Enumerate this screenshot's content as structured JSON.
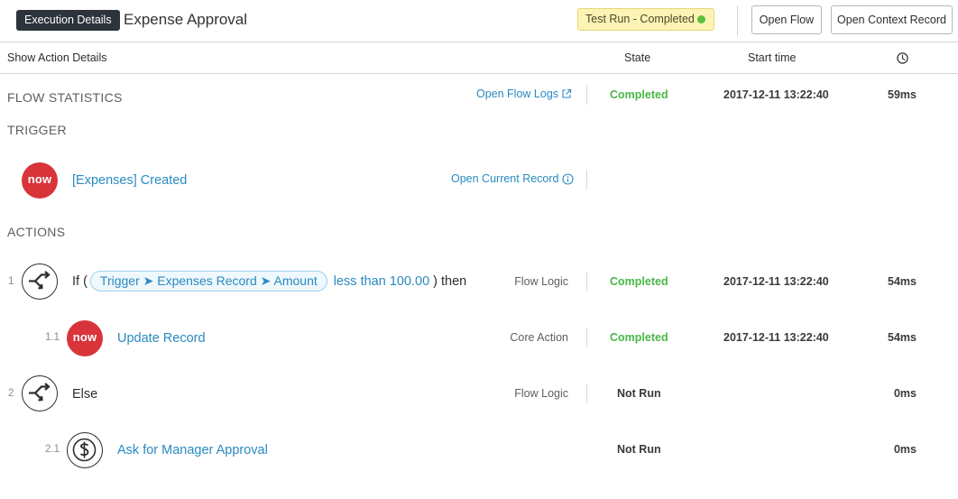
{
  "header": {
    "badge": "Execution Details",
    "title": "Expense Approval",
    "status": "Test Run - Completed",
    "open_flow": "Open Flow",
    "open_context": "Open Context Record"
  },
  "columns": {
    "show_details": "Show Action Details",
    "state": "State",
    "start_time": "Start time"
  },
  "flow_statistics": {
    "title": "FLOW STATISTICS",
    "link": "Open Flow Logs",
    "state": "Completed",
    "start": "2017-12-11 13:22:40",
    "duration": "59ms"
  },
  "trigger": {
    "title": "TRIGGER",
    "logo_text": "now",
    "label": "[Expenses] Created",
    "link": "Open Current Record"
  },
  "actions": {
    "title": "ACTIONS",
    "items": [
      {
        "num": "1",
        "prefix": "If (",
        "pill": "Trigger ➤ Expenses Record ➤ Amount",
        "operator": "less than 100.00",
        "suffix": ") then",
        "type": "Flow Logic",
        "state": "Completed",
        "start": "2017-12-11 13:22:40",
        "duration": "54ms"
      },
      {
        "num": "1.1",
        "logo_text": "now",
        "label": "Update Record",
        "type": "Core Action",
        "state": "Completed",
        "start": "2017-12-11 13:22:40",
        "duration": "54ms"
      },
      {
        "num": "2",
        "label": "Else",
        "type": "Flow Logic",
        "state": "Not Run",
        "duration": "0ms"
      },
      {
        "num": "2.1",
        "label": "Ask for Manager Approval",
        "state": "Not Run",
        "duration": "0ms"
      }
    ]
  },
  "icons": {
    "clock": "clock-icon",
    "external": "external-link-icon",
    "info": "info-icon",
    "branch": "flow-logic-branch-icon",
    "dollar": "dollar-icon"
  },
  "colors": {
    "link": "#2a8ac0",
    "completed": "#4ab646",
    "now_logo": "#d8343a",
    "status_bg": "#fdf3b4",
    "status_dot": "#5dbf3f"
  }
}
